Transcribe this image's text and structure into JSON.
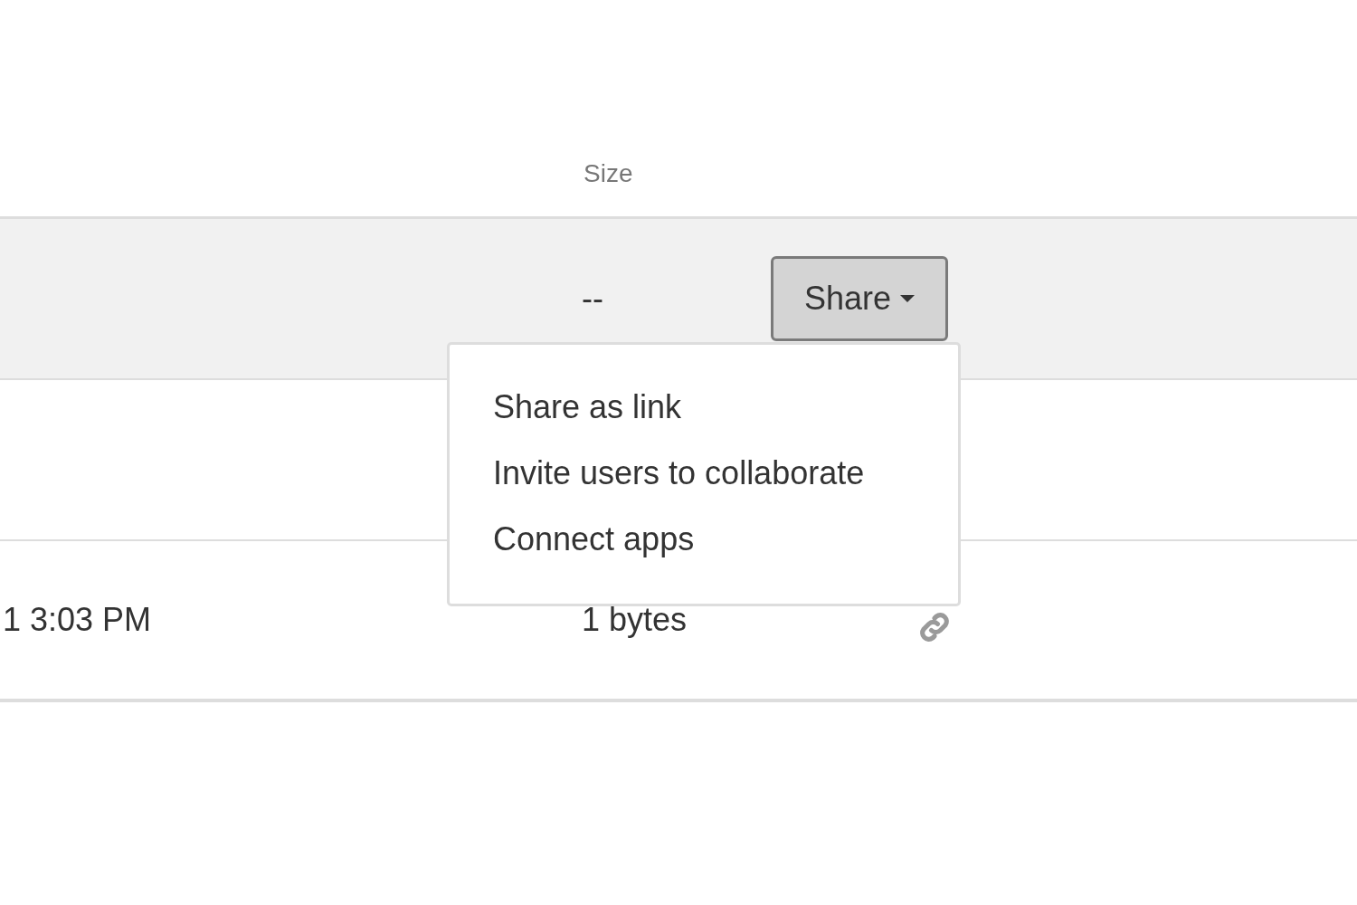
{
  "table": {
    "columns": [
      {
        "label": "Size"
      }
    ],
    "rows": [
      {
        "selected": true,
        "size": "--",
        "share_button": "Share",
        "menu_open": true
      },
      {
        "selected": false
      },
      {
        "selected": false,
        "modified": "1 3:03 PM",
        "size": "1 bytes",
        "shared": true
      }
    ]
  },
  "share_menu": {
    "items": [
      "Share as link",
      "Invite users to collaborate",
      "Connect apps"
    ]
  }
}
